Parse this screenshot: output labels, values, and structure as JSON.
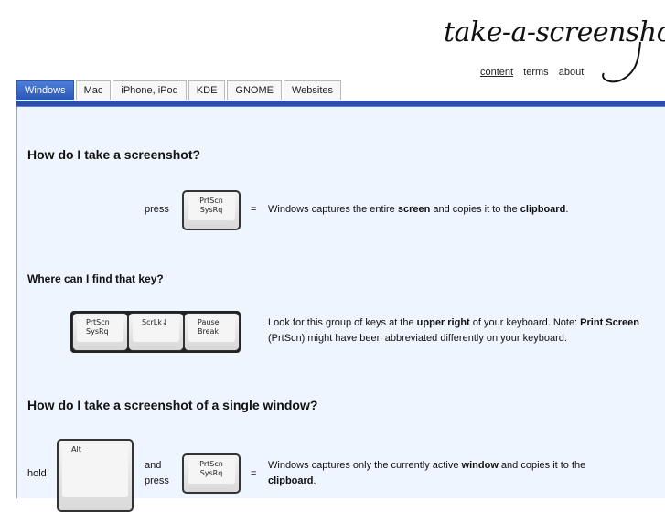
{
  "site": {
    "logo": "take-a-screenshot.org",
    "nav": [
      {
        "label": "content",
        "active": true
      },
      {
        "label": "terms",
        "active": false
      },
      {
        "label": "about",
        "active": false
      }
    ]
  },
  "tabs": [
    {
      "label": "Windows",
      "selected": true
    },
    {
      "label": "Mac",
      "selected": false
    },
    {
      "label": "iPhone, iPod",
      "selected": false
    },
    {
      "label": "KDE",
      "selected": false
    },
    {
      "label": "GNOME",
      "selected": false
    },
    {
      "label": "Websites",
      "selected": false
    }
  ],
  "sections": {
    "s1": {
      "heading": "How do I take a screenshot?",
      "press_label": "press",
      "key": {
        "line1": "PrtScn",
        "line2": "SysRq"
      },
      "equals": "=",
      "desc_pre": "Windows captures the entire ",
      "desc_b1": "screen",
      "desc_mid": " and copies it to the ",
      "desc_b2": "clipboard",
      "desc_post": "."
    },
    "s2": {
      "heading": "Where can I find that key?",
      "keys": [
        {
          "line1": "PrtScn",
          "line2": "SysRq"
        },
        {
          "line1": "ScrLk↓",
          "line2": ""
        },
        {
          "line1": "Pause",
          "line2": "Break"
        }
      ],
      "desc_pre": "Look for this group of keys at the ",
      "desc_b1": "upper right",
      "desc_mid": " of your keyboard. Note: ",
      "desc_b2": "Print Screen",
      "desc_post": " (PrtScn) might have been abbreviated differently on your keyboard."
    },
    "s3": {
      "heading": "How do I take a screenshot of a single window?",
      "hold_label": "hold",
      "alt_key": "Alt",
      "and_label": "and",
      "press_label": "press",
      "key": {
        "line1": "PrtScn",
        "line2": "SysRq"
      },
      "equals": "=",
      "desc_pre": "Windows captures only the currently active ",
      "desc_b1": "window",
      "desc_mid": " and copies it to the ",
      "desc_b2": "clipboard",
      "desc_post": "."
    }
  }
}
